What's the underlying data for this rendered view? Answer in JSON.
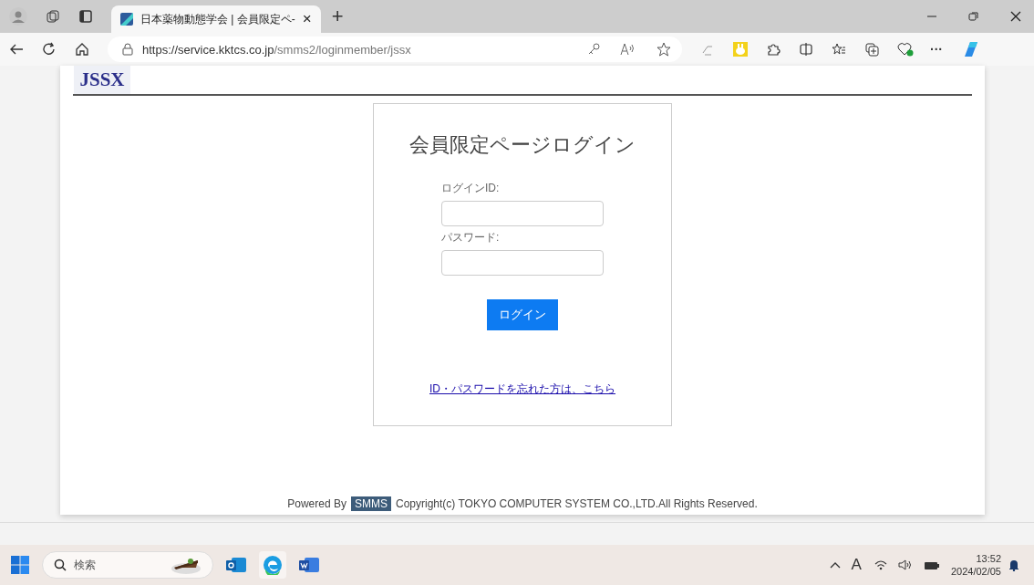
{
  "browser": {
    "tab_title": "日本薬物動態学会 | 会員限定ペ-",
    "tab_close": "×",
    "new_tab": "+",
    "url_host": "https://service.kktcs.co.jp",
    "url_path": "/smms2/loginmember/jssx",
    "more": "···"
  },
  "page": {
    "logo": "JSSX",
    "heading": "会員限定ページログイン",
    "fields": [
      {
        "label": "ログインID:"
      },
      {
        "label": "パスワード:"
      }
    ],
    "login_button": "ログイン",
    "forgot_link": "ID・パスワードを忘れた方は、こちら"
  },
  "footer": {
    "powered": "Powered By",
    "badge": "SMMS",
    "copyright": "Copyright(c) TOKYO COMPUTER SYSTEM CO.,LTD.All Rights Reserved."
  },
  "taskbar": {
    "search": "検索",
    "time": "13:52",
    "date": "2024/02/05",
    "ime": "A"
  }
}
